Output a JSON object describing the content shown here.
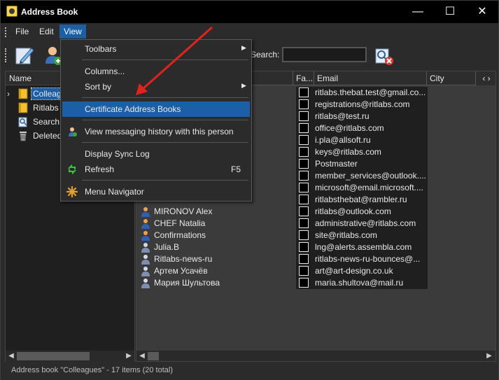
{
  "window": {
    "title": "Address Book",
    "min_glyph": "—",
    "max_glyph": "☐",
    "close_glyph": "✕"
  },
  "menubar": {
    "items": [
      "File",
      "Edit",
      "View"
    ]
  },
  "toolbar": {
    "search_label": "Search:",
    "search_value": "",
    "icons": [
      "edit-contact-icon",
      "new-contact-icon",
      "search-contacts-icon"
    ]
  },
  "left_pane": {
    "header": "Name",
    "items": [
      {
        "label": "Colleagues",
        "icon": "address-book-icon",
        "expander": "›",
        "selected": true
      },
      {
        "label": "Ritlabs",
        "icon": "address-book-icon",
        "expander": "",
        "selected": false
      },
      {
        "label": "Search",
        "icon": "search-folder-icon",
        "expander": "",
        "selected": false
      },
      {
        "label": "Deleted",
        "icon": "trash-icon",
        "expander": "",
        "selected": false
      }
    ]
  },
  "right_pane": {
    "columns": [
      "Fa...",
      "Email",
      "City"
    ],
    "nav": "‹ ›",
    "rows": [
      {
        "name": "",
        "email": "ritlabs.thebat.test@gmail.co..."
      },
      {
        "name": "",
        "email": "registrations@ritlabs.com"
      },
      {
        "name": "",
        "email": "ritlabs@test.ru"
      },
      {
        "name": "",
        "email": "office@ritlabs.com"
      },
      {
        "name": "",
        "email": "i.pla@allsoft.ru"
      },
      {
        "name": "",
        "email": "keys@ritlabs.com"
      },
      {
        "name": "",
        "email": "Postmaster"
      },
      {
        "name": "",
        "email": "member_services@outlook...."
      },
      {
        "name": "",
        "email": "microsoft@email.microsoft...."
      },
      {
        "name": "",
        "email": "ritlabsthebat@rambler.ru"
      },
      {
        "name": "MIRONOV Alex",
        "email": "ritlabs@outlook.com",
        "icon": "person-orange-icon"
      },
      {
        "name": "CHEF Natalia",
        "email": "administrative@ritlabs.com",
        "icon": "person-orange-icon"
      },
      {
        "name": "Confirmations",
        "email": "site@ritlabs.com",
        "icon": "person-orange-icon"
      },
      {
        "name": "Julia.B",
        "email": "lng@alerts.assembla.com",
        "icon": "person-grey-icon"
      },
      {
        "name": "Ritlabs-news-ru",
        "email": "ritlabs-news-ru-bounces@...",
        "icon": "person-grey-icon"
      },
      {
        "name": "Артем Усачёв",
        "email": "art@art-design.co.uk",
        "icon": "person-grey-icon"
      },
      {
        "name": "Мария Шультова",
        "email": "maria.shultova@mail.ru",
        "icon": "person-grey-icon"
      }
    ]
  },
  "dropdown": {
    "items": [
      {
        "label": "Toolbars",
        "submenu": true
      },
      {
        "label": "Columns...",
        "submenu": false
      },
      {
        "label": "Sort by",
        "submenu": true
      },
      {
        "label": "Certificate Address Books",
        "submenu": false,
        "highlighted": true
      },
      {
        "label": "View messaging history with this person",
        "icon": "history-person-icon"
      },
      {
        "label": "Display Sync Log"
      },
      {
        "label": "Refresh",
        "shortcut": "F5",
        "icon": "refresh-icon"
      },
      {
        "label": "Menu Navigator",
        "icon": "menu-navigator-icon"
      }
    ]
  },
  "statusbar": {
    "text": "Address book \"Colleagues\" - 17 items (20 total)"
  },
  "colors": {
    "accent": "#1c5fa6",
    "annotation_arrow": "#e0231c"
  }
}
